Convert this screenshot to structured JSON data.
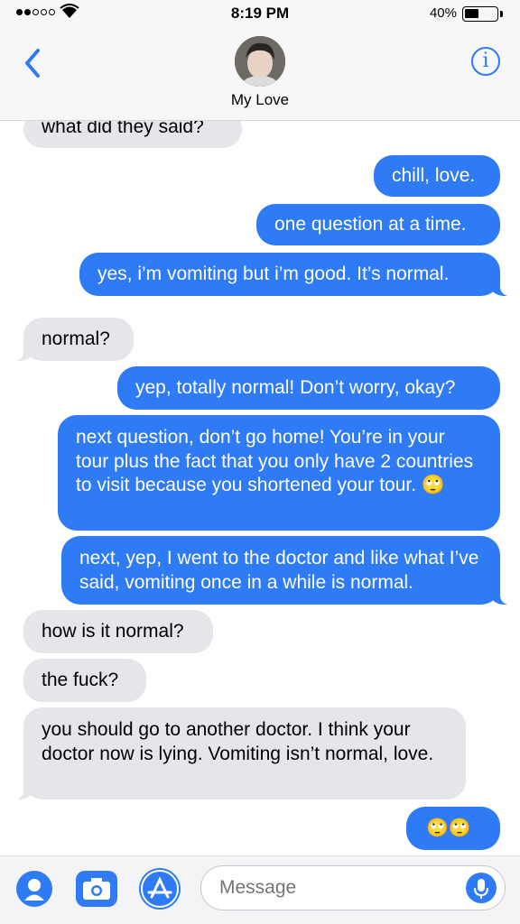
{
  "status_bar": {
    "time": "8:19 PM",
    "battery_percent": "40%",
    "battery_level": 0.4,
    "signal_bars_filled": 2,
    "signal_bars_total": 5
  },
  "header": {
    "contact_name": "My Love",
    "back_icon": "chevron-left-icon",
    "info_icon": "info-icon",
    "info_glyph": "i"
  },
  "messages": [
    {
      "side": "in",
      "text": "what did they said?"
    },
    {
      "side": "out",
      "text": "chill, love."
    },
    {
      "side": "out",
      "text": "one question at a time."
    },
    {
      "side": "out",
      "text": "yes, i’m vomiting but i’m good. It’s normal."
    },
    {
      "side": "in",
      "text": "normal?"
    },
    {
      "side": "out",
      "text": "yep, totally normal! Don’t worry, okay?"
    },
    {
      "side": "out",
      "text": "next question, don’t go home! You’re in your tour plus the fact that you only have 2 countries to visit because you shortened your tour. 🙄"
    },
    {
      "side": "out",
      "text": "next, yep, I went to the doctor and like what I’ve said, vomiting once in a while is normal."
    },
    {
      "side": "in",
      "text": "how is it normal?"
    },
    {
      "side": "in",
      "text": "the fuck?"
    },
    {
      "side": "in",
      "text": "you should go to another doctor. I think your doctor now is lying. Vomiting isn’t normal, love."
    },
    {
      "side": "out",
      "text": "🙄🙄"
    }
  ],
  "composer": {
    "placeholder": "Message",
    "left_icons": [
      "person-icon",
      "camera-icon",
      "app-store-icon"
    ],
    "mic_icon": "microphone-icon"
  },
  "colors": {
    "outgoing": "#2f7bf6",
    "incoming": "#e5e5ea",
    "accent": "#2f7bf6"
  }
}
